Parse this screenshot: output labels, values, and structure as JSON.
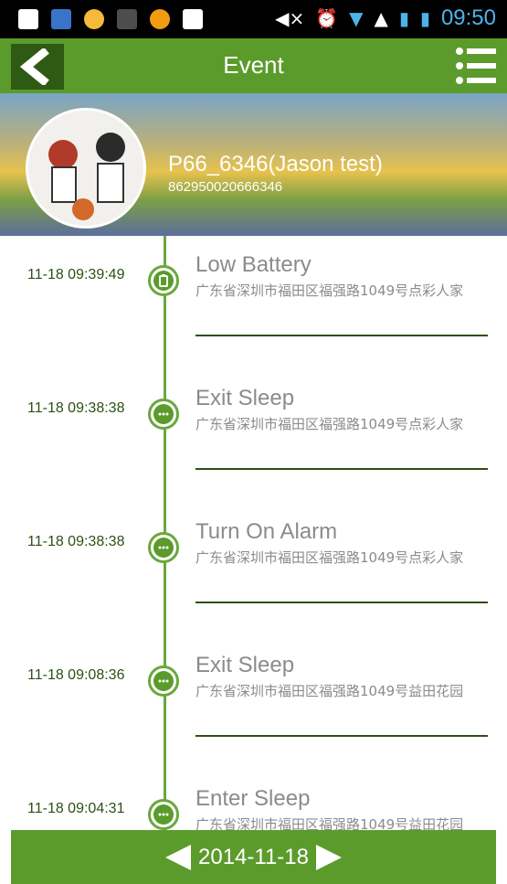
{
  "status_bar": {
    "time": "09:50"
  },
  "header": {
    "title": "Event"
  },
  "device": {
    "name": "P66_6346(Jason test)",
    "id": "862950020666346"
  },
  "events": [
    {
      "time": "11-18 09:39:49",
      "title": "Low Battery",
      "address": "广东省深圳市福田区福强路1049号点彩人家",
      "icon": "battery-icon"
    },
    {
      "time": "11-18 09:38:38",
      "title": "Exit Sleep",
      "address": "广东省深圳市福田区福强路1049号点彩人家",
      "icon": "chat-bubble-icon"
    },
    {
      "time": "11-18 09:38:38",
      "title": "Turn On Alarm",
      "address": "广东省深圳市福田区福强路1049号点彩人家",
      "icon": "chat-bubble-icon"
    },
    {
      "time": "11-18 09:08:36",
      "title": "Exit Sleep",
      "address": "广东省深圳市福田区福强路1049号益田花园",
      "icon": "chat-bubble-icon"
    },
    {
      "time": "11-18 09:04:31",
      "title": "Enter Sleep",
      "address": "广东省深圳市福田区福强路1049号益田花园",
      "icon": "chat-bubble-icon"
    }
  ],
  "footer": {
    "date": "2014-11-18"
  },
  "colors": {
    "primary": "#5b9b2c",
    "dark": "#2c5014",
    "text_muted": "#8b8b8b"
  }
}
